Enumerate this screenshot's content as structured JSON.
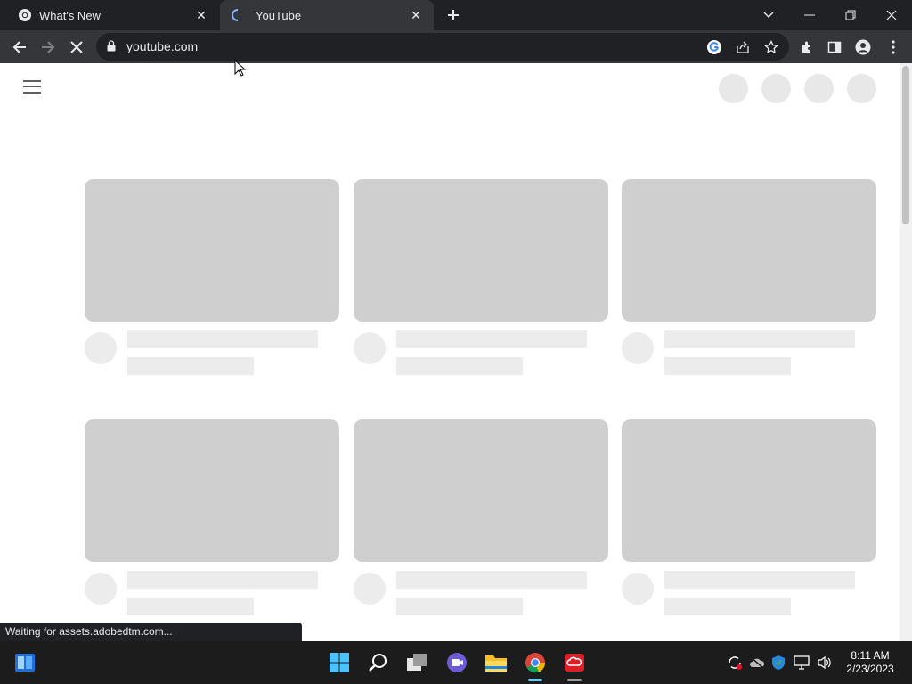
{
  "browser": {
    "tabs": [
      {
        "title": "What's New",
        "icon": "chrome-icon",
        "active": false
      },
      {
        "title": "YouTube",
        "icon": "loading-spinner-icon",
        "active": true
      }
    ],
    "address": "youtube.com",
    "status_text": "Waiting for assets.adobedtm.com..."
  },
  "taskbar": {
    "time": "8:11 AM",
    "date": "2/23/2023"
  },
  "colors": {
    "tabstrip": "#202124",
    "toolbar": "#35363a",
    "placeholder": "#cfcfcf",
    "taskbar": "#1c1c1c"
  }
}
